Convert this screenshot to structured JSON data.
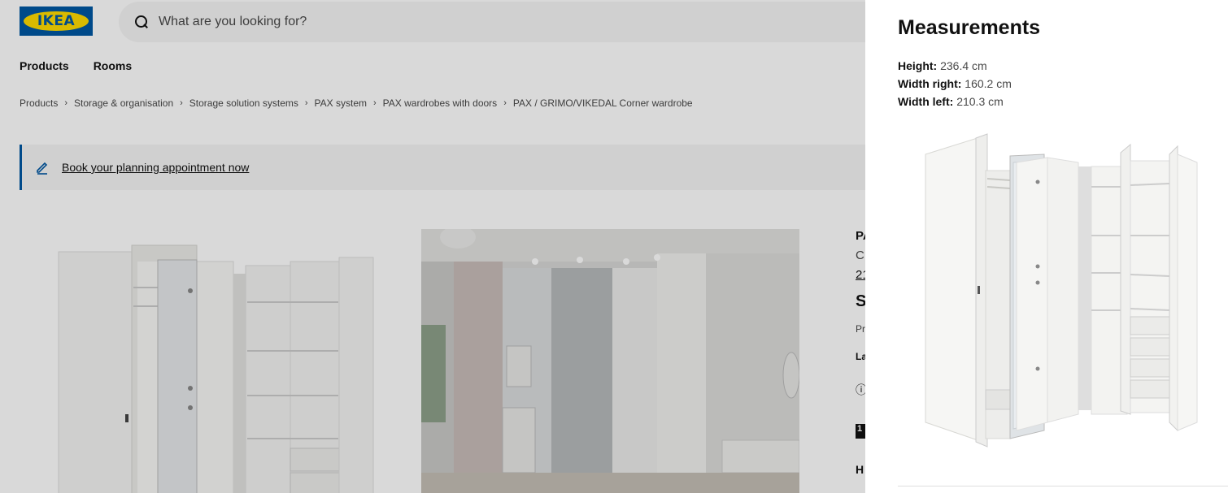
{
  "header": {
    "logo_text": "IKEA",
    "search_placeholder": "What are you looking for?",
    "search_icon": "search-icon"
  },
  "nav": {
    "items": [
      "Products",
      "Rooms"
    ]
  },
  "breadcrumb": [
    "Products",
    "Storage & organisation",
    "Storage solution systems",
    "PAX system",
    "PAX wardrobes with doors",
    "PAX / GRIMO/VIKEDAL Corner wardrobe"
  ],
  "banner": {
    "link_text": "Book your planning appointment now",
    "icon": "pencil-icon"
  },
  "product_info_partial": {
    "name": "PA",
    "description": "C",
    "measure_link": "21",
    "price": "S",
    "note": "Pr",
    "label": "La",
    "info_icon": "info-icon",
    "badge": "1",
    "heading": "H"
  },
  "panel": {
    "title": "Measurements",
    "measurements": [
      {
        "label": "Height:",
        "value": "236.4 cm"
      },
      {
        "label": "Width right:",
        "value": "160.2 cm"
      },
      {
        "label": "Width left:",
        "value": "210.3 cm"
      }
    ]
  },
  "colors": {
    "brand_blue": "#0058a3",
    "brand_yellow": "#ffdb00"
  }
}
